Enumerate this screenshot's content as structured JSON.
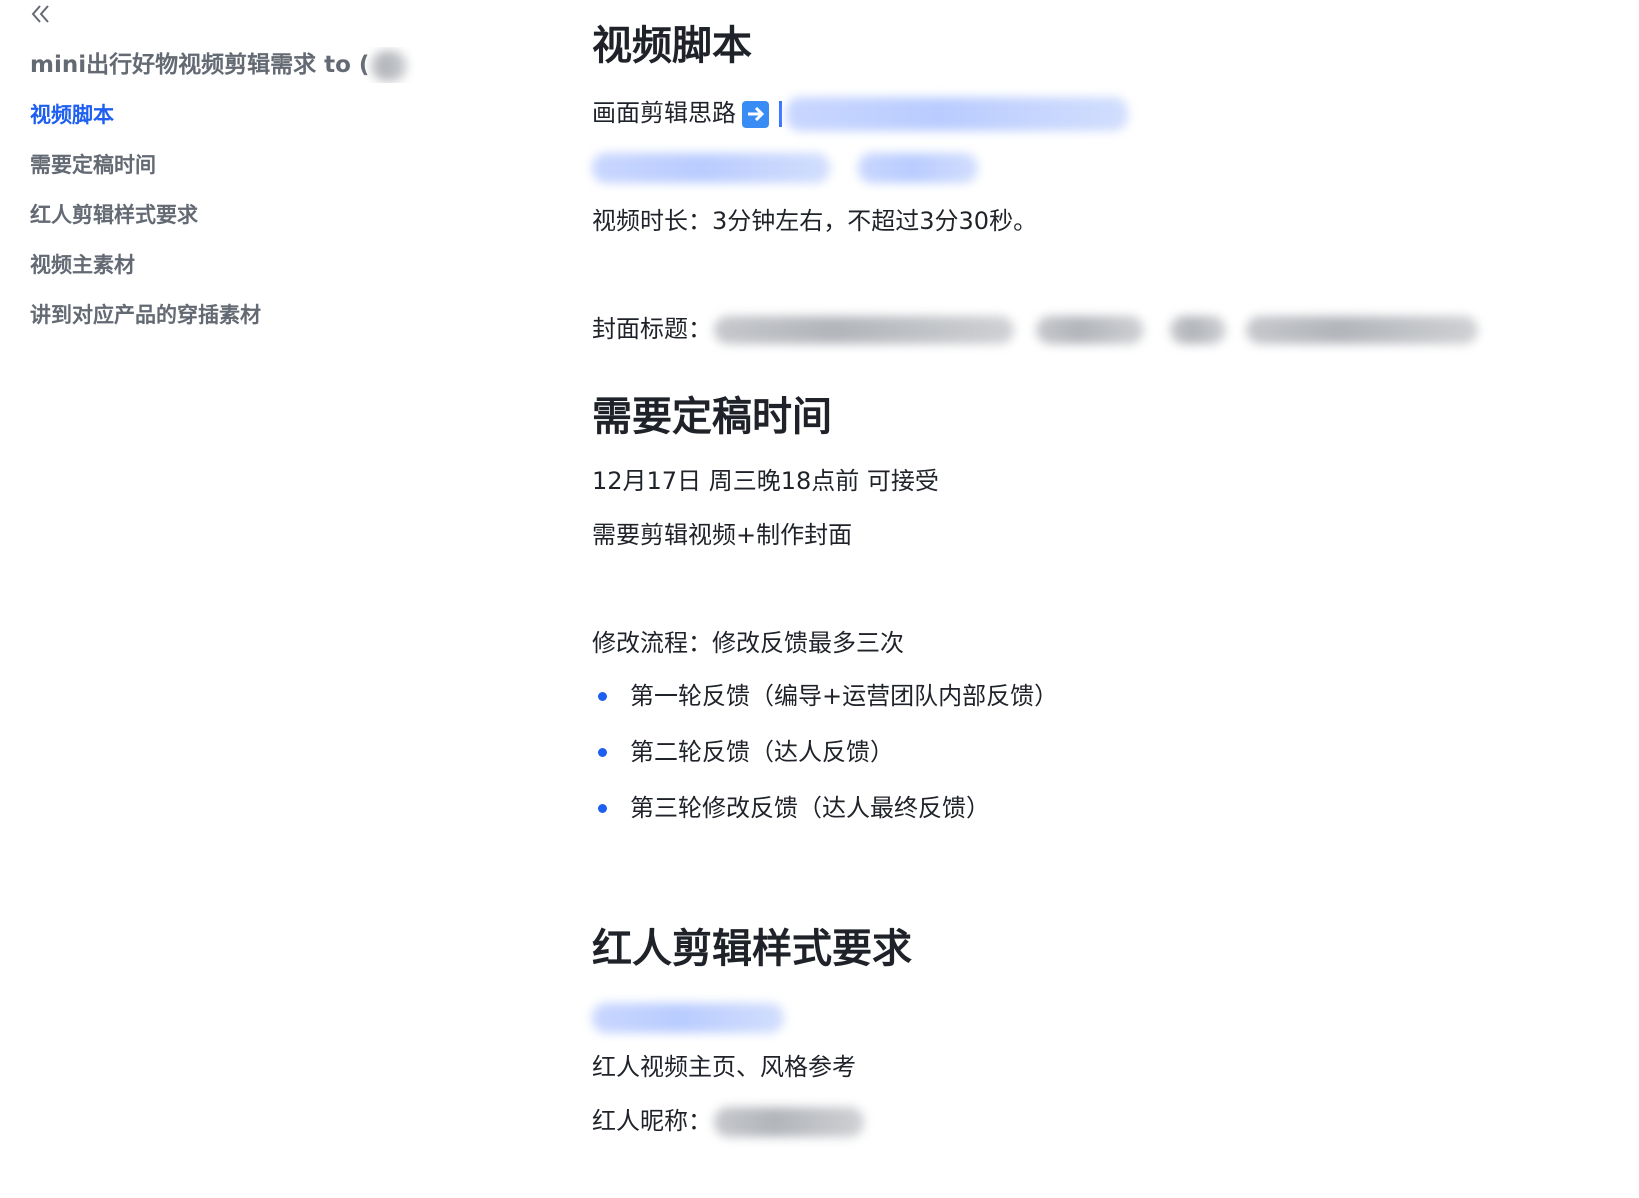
{
  "sidebar": {
    "doc_title": "mini出行好物视频剪辑需求 to (",
    "outline": [
      {
        "label": "视频脚本",
        "active": true
      },
      {
        "label": "需要定稿时间",
        "active": false
      },
      {
        "label": "红人剪辑样式要求",
        "active": false
      },
      {
        "label": "视频主素材",
        "active": false
      },
      {
        "label": "讲到对应产品的穿插素材",
        "active": false
      }
    ]
  },
  "main": {
    "section_script": {
      "heading": "视频脚本",
      "edit_idea_label": "画面剪辑思路",
      "duration_text": "视频时长：3分钟左右，不超过3分30秒。",
      "cover_title_label": "封面标题："
    },
    "section_deadline": {
      "heading": "需要定稿时间",
      "deadline_text": "12月17日 周三晚18点前   可接受",
      "task_text": "需要剪辑视频+制作封面",
      "revision_label": "修改流程：修改反馈最多三次",
      "revision_rounds": [
        "第一轮反馈（编导+运营团队内部反馈）",
        "第二轮反馈（达人反馈）",
        "第三轮修改反馈（达人最终反馈）"
      ]
    },
    "section_style": {
      "heading": "红人剪辑样式要求",
      "homepage_text": "红人视频主页、风格参考",
      "nickname_label": "红人昵称："
    }
  },
  "colors": {
    "accent": "#1e5ef0",
    "text": "#1f2329",
    "muted": "#646a73"
  },
  "icons": {
    "collapse": "double-chevron-left-icon",
    "arrow": "right-arrow-emoji-icon"
  }
}
